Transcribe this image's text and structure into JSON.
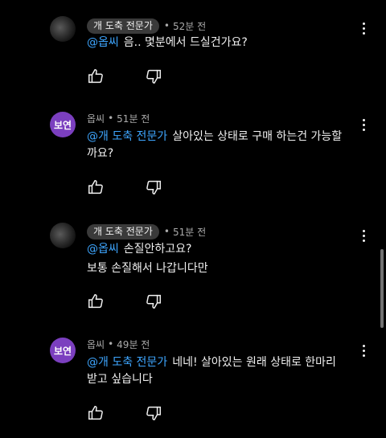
{
  "comments": [
    {
      "badge": "개 도축 전문가",
      "time": "52분 전",
      "mention": "@옵씨",
      "lines": [
        "음.. 몇분에서 드실건가요?"
      ]
    },
    {
      "avatar_text": "보연",
      "name": "옵씨",
      "time": "51분 전",
      "mention": "@개 도축 전문가",
      "lines": [
        "살아있는 상태로 구매 하는건 가능할",
        "까요?"
      ]
    },
    {
      "badge": "개 도축 전문가",
      "time": "51분 전",
      "mention": "@옵씨",
      "lines": [
        "손질안하고요?",
        "보통 손질해서 나갑니다만"
      ]
    },
    {
      "avatar_text": "보연",
      "name": "옵씨",
      "time": "49분 전",
      "mention": "@개 도축 전문가",
      "lines": [
        "네네! 살아있는 원래 상태로 한마리",
        "받고 싶습니다"
      ]
    }
  ],
  "meta_separator": "•",
  "icons": {
    "like": "thumbs-up-icon",
    "dislike": "thumbs-down-icon",
    "more": "more-vertical-icon"
  },
  "colors": {
    "mention": "#3ea6ff",
    "avatar_bg": "#7b3fbf",
    "badge_bg": "#3a3a3a"
  }
}
